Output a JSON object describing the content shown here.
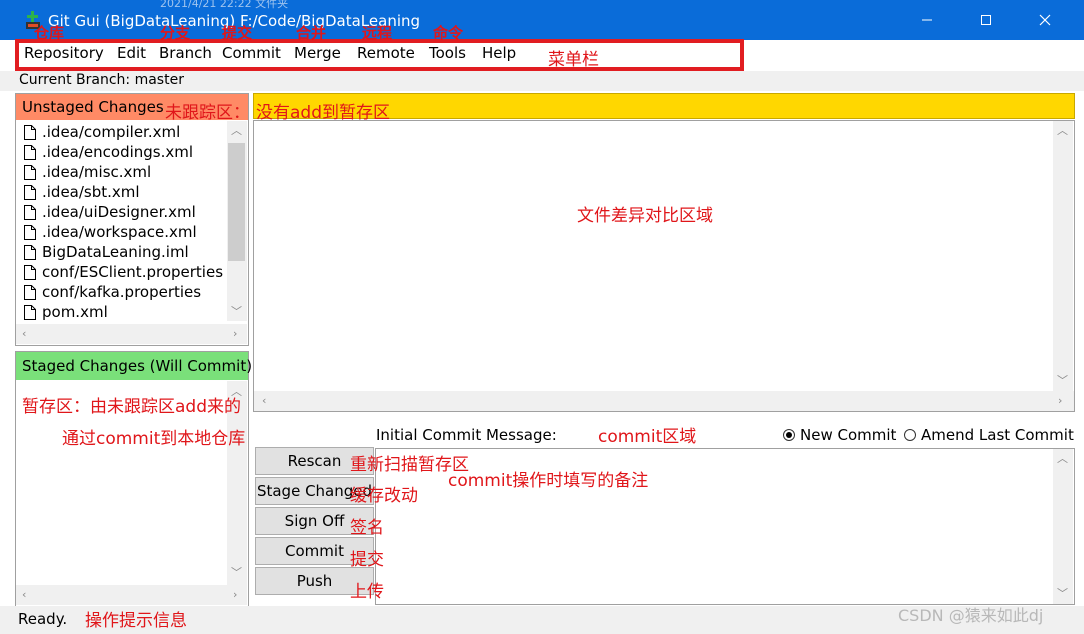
{
  "window": {
    "top_faded_text": "2021/4/21 22:22      文件夹",
    "title": "Git Gui (BigDataLeaning) F:/Code/BigDataLeaning",
    "minimize_glyph": "—",
    "maximize_glyph": "☐",
    "close_glyph": "✕"
  },
  "menu": {
    "items": [
      "Repository",
      "Edit",
      "Branch",
      "Commit",
      "Merge",
      "Remote",
      "Tools",
      "Help"
    ]
  },
  "branch": {
    "label": "Current Branch: master"
  },
  "unstaged": {
    "title": "Unstaged Changes",
    "files": [
      ".idea/compiler.xml",
      ".idea/encodings.xml",
      ".idea/misc.xml",
      ".idea/sbt.xml",
      ".idea/uiDesigner.xml",
      ".idea/workspace.xml",
      "BigDataLeaning.iml",
      "conf/ESClient.properties",
      "conf/kafka.properties",
      "pom.xml"
    ]
  },
  "staged": {
    "title": "Staged Changes (Will Commit)"
  },
  "commit": {
    "message_label": "Initial Commit Message:",
    "radio_new": "New Commit",
    "radio_amend": "Amend Last Commit",
    "new_selected": true
  },
  "buttons": {
    "rescan": "Rescan",
    "stage_changed": "Stage Changed",
    "sign_off": "Sign Off",
    "commit": "Commit",
    "push": "Push"
  },
  "status": {
    "text": "Ready."
  },
  "annotations": {
    "menu_words": [
      "仓库",
      "分支",
      "提交",
      "合并",
      "远程",
      "命令"
    ],
    "menubar": "菜单栏",
    "untracked_area": "未跟踪区：",
    "not_added": "没有add到暂存区",
    "diff_area": "文件差异对比区域",
    "staging_area": "暂存区：由未跟踪区add来的",
    "commit_to_local": "通过commit到本地仓库",
    "commit_area": "commit区域",
    "rescan_desc": "重新扫描暂存区",
    "commit_note": "commit操作时填写的备注",
    "stage_desc": "缓存改动",
    "signoff_desc": "签名",
    "commit_desc": "提交",
    "push_desc": "上传",
    "status_desc": "操作提示信息"
  },
  "watermark": "CSDN @猿来如此dj",
  "colors": {
    "titlebar": "#0a6cd9",
    "unstaged_header": "#ff8a65",
    "staged_header": "#7ae07a",
    "diff_header": "#ffd700",
    "annotation_red": "#e0161a"
  }
}
